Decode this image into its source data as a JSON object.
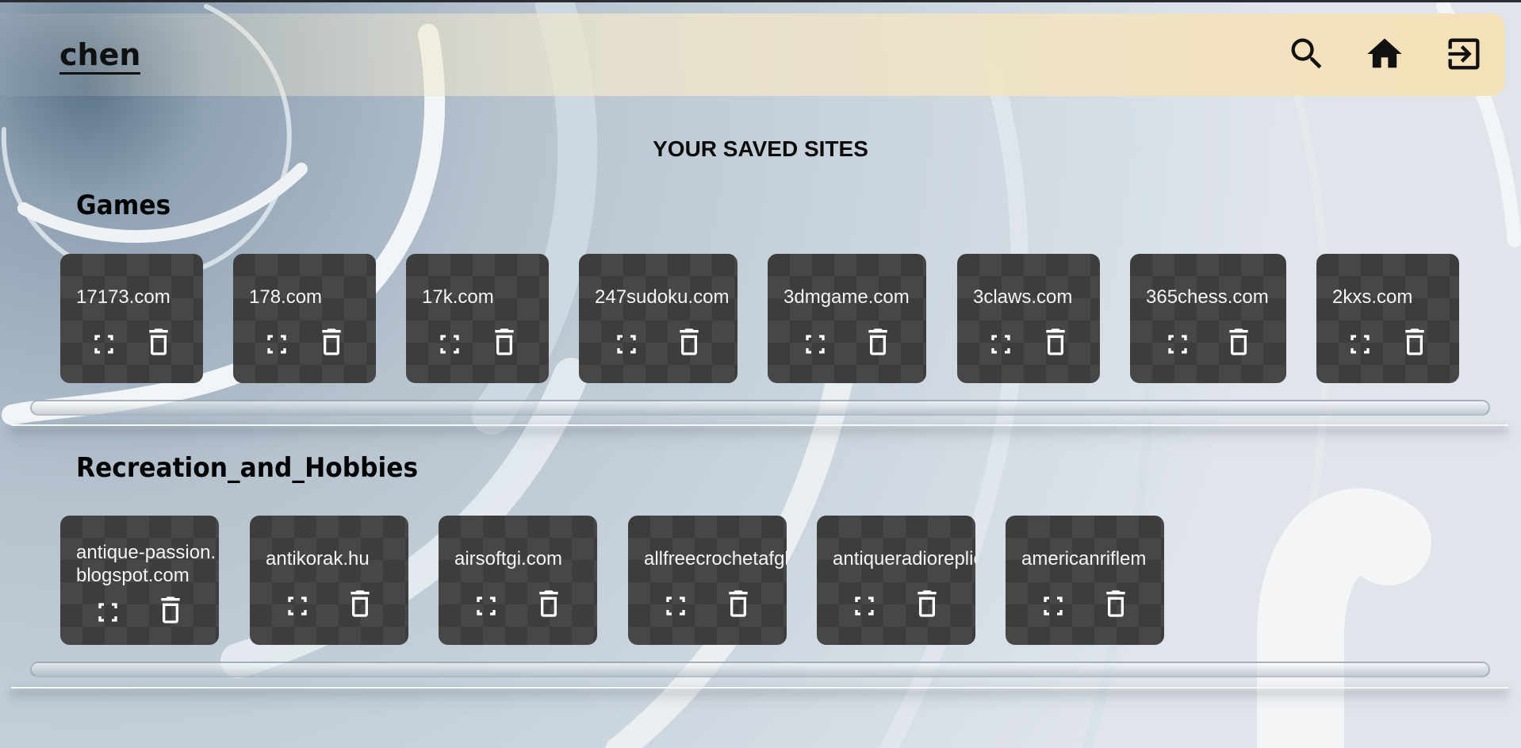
{
  "header": {
    "username": "chen",
    "icons": {
      "search": "search-icon",
      "home": "home-icon",
      "logout": "logout-icon"
    }
  },
  "page": {
    "heading": "YOUR SAVED SITES"
  },
  "categories": [
    {
      "title": "Games",
      "sites": [
        {
          "label": "17173.com"
        },
        {
          "label": "178.com"
        },
        {
          "label": "17k.com"
        },
        {
          "label": "247sudoku.com"
        },
        {
          "label": "3dmgame.com"
        },
        {
          "label": "3claws.com"
        },
        {
          "label": "365chess.com"
        },
        {
          "label": "2kxs.com"
        }
      ]
    },
    {
      "title": "Recreation_and_Hobbies",
      "sites": [
        {
          "label": "antique-passion.blogspot.com"
        },
        {
          "label": "antikorak.hu"
        },
        {
          "label": "airsoftgi.com"
        },
        {
          "label": "allfreecrochetafghanpatterns.com"
        },
        {
          "label": "antiqueradioreplicas.com"
        },
        {
          "label": "americanriflem"
        }
      ]
    }
  ],
  "card_icons": {
    "open": "expand-icon",
    "delete": "trash-icon"
  },
  "colors": {
    "card_bg": "#3d3d3d",
    "header_bg": "#f5e1b8",
    "text_dark": "#111111"
  }
}
